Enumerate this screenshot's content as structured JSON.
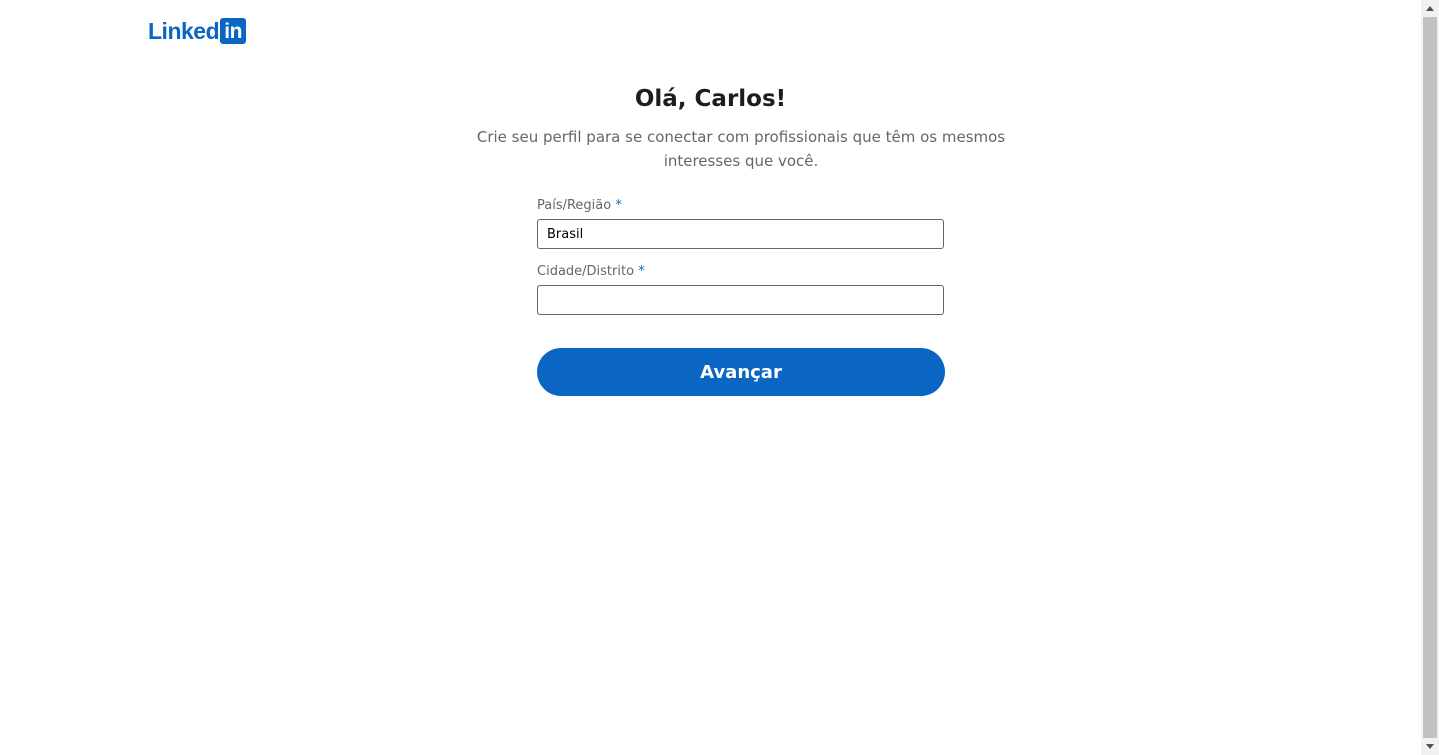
{
  "brand": {
    "word": "Linked",
    "box": "in",
    "color": "#0a66c2"
  },
  "heading": "Olá, Carlos!",
  "subtitle": "Crie seu perfil para se conectar com profissionais que têm os mesmos interesses que você.",
  "form": {
    "country": {
      "label": "País/Região",
      "required_mark": "*",
      "value": "Brasil"
    },
    "city": {
      "label": "Cidade/Distrito",
      "required_mark": "*",
      "value": ""
    },
    "submit_label": "Avançar"
  },
  "scrollbar": {
    "up_icon": "arrow-up-icon",
    "down_icon": "arrow-down-icon"
  }
}
